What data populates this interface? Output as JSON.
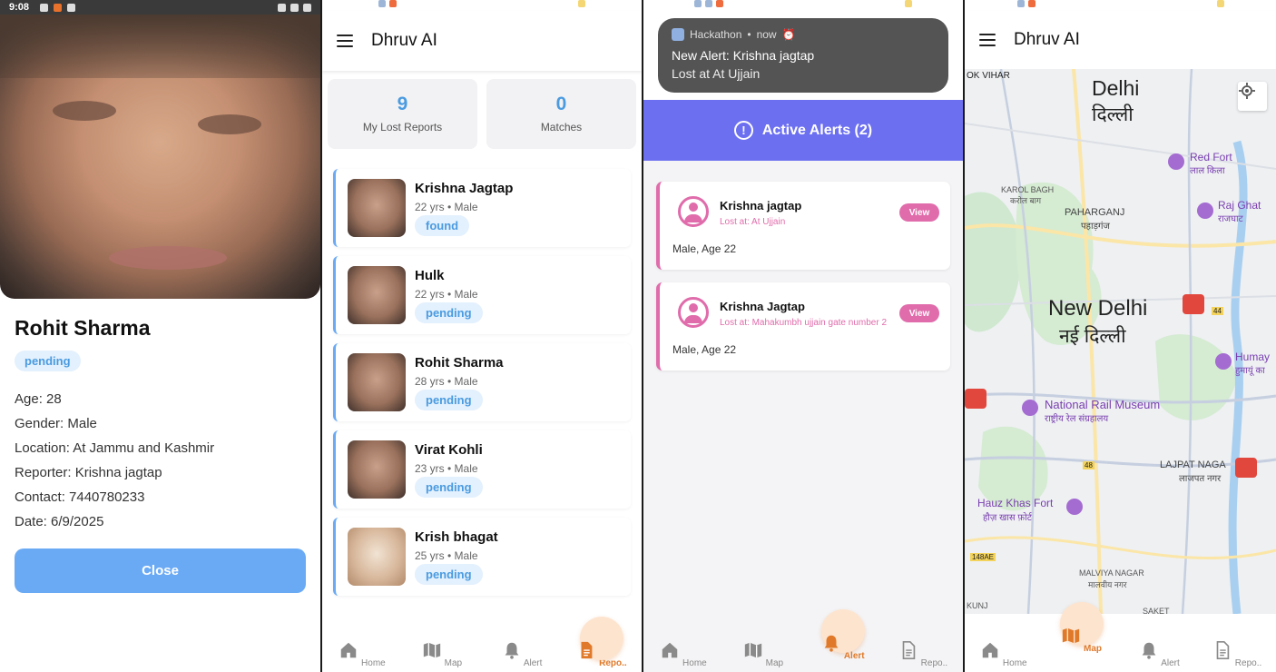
{
  "status_bar": {
    "time": "9:08"
  },
  "detail": {
    "name": "Rohit Sharma",
    "status": "pending",
    "info": [
      "Age: 28",
      "Gender: Male",
      "Location: At Jammu and Kashmir",
      "Reporter: Krishna jagtap",
      "Contact: 7440780233",
      "Date: 6/9/2025"
    ],
    "close_label": "Close"
  },
  "reports_screen": {
    "app_title": "Dhruv AI",
    "stats": [
      {
        "value": "9",
        "label": "My Lost Reports"
      },
      {
        "value": "0",
        "label": "Matches"
      }
    ],
    "reports": [
      {
        "name": "Krishna Jagtap",
        "sub": "22 yrs • Male",
        "status": "found"
      },
      {
        "name": "Hulk",
        "sub": "22 yrs • Male",
        "status": "pending"
      },
      {
        "name": "Rohit Sharma",
        "sub": "28 yrs • Male",
        "status": "pending"
      },
      {
        "name": "Virat Kohli",
        "sub": "23 yrs • Male",
        "status": "pending"
      },
      {
        "name": "Krish bhagat",
        "sub": "25 yrs • Male",
        "status": "pending"
      }
    ]
  },
  "alerts_screen": {
    "notification": {
      "app": "Hackathon",
      "when": "now",
      "title": "New Alert: Krishna jagtap",
      "body": "Lost at At Ujjain"
    },
    "banner": "Active Alerts (2)",
    "alerts": [
      {
        "name": "Krishna jagtap",
        "location": "Lost at: At Ujjain",
        "desc": "Male, Age 22",
        "view_label": "View"
      },
      {
        "name": "Krishna Jagtap",
        "location": "Lost at: Mahakumbh ujjain gate number 2",
        "desc": "Male, Age 22",
        "view_label": "View"
      }
    ]
  },
  "map_screen": {
    "app_title": "Dhruv AI",
    "labels": {
      "ok_vihar": "OK VIHAR",
      "delhi_en": "Delhi",
      "delhi_hi": "दिल्ली",
      "red_fort_en": "Red Fort",
      "red_fort_hi": "लाल किला",
      "karol_bagh_en": "KAROL BAGH",
      "karol_bagh_hi": "करोल बाग",
      "raj_ghat_en": "Raj Ghat",
      "raj_ghat_hi": "राजघाट",
      "paharganj_en": "PAHARGANJ",
      "paharganj_hi": "पहाड़गंज",
      "new_delhi_en": "New Delhi",
      "new_delhi_hi": "नई दिल्ली",
      "humayun_en": "Humay",
      "humayun_hi": "हुमायूं का",
      "rail_museum_en": "National Rail Museum",
      "rail_museum_hi": "राष्ट्रीय रेल संग्रहालय",
      "lajpat_en": "LAJPAT NAGA",
      "lajpat_hi": "लाजपत नगर",
      "hauz_khas_en": "Hauz Khas Fort",
      "hauz_khas_hi": "हौज़ खास फ़ोर्ट",
      "malviya_en": "MALVIYA NAGAR",
      "malviya_hi": "मालवीय नगर",
      "saket": "SAKET",
      "kunj": "KUNJ",
      "road_48": "48",
      "road_44": "44",
      "road_148ae": "148AE"
    }
  },
  "nav": {
    "home": "Home",
    "map": "Map",
    "alert": "Alert",
    "reports": "Repo.."
  },
  "colors": {
    "primary_blue": "#6aaaf5",
    "accent_orange": "#e07a2a",
    "alert_purple": "#6c6ff0",
    "alert_pink": "#e06cab"
  }
}
